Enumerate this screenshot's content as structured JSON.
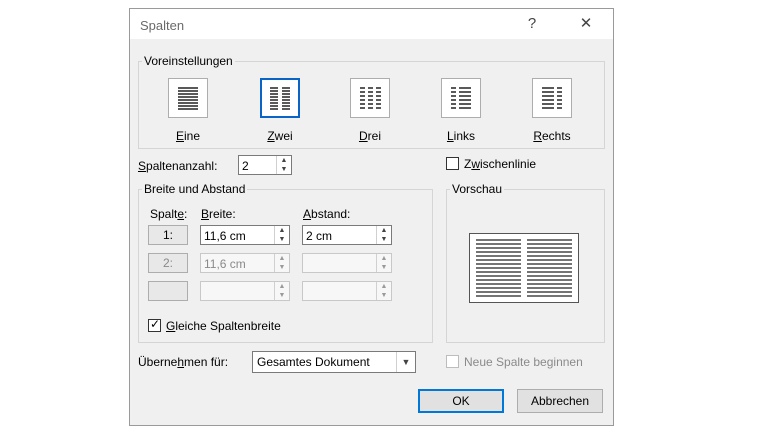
{
  "title": "Spalten",
  "titlebar": {
    "help": "?",
    "close": "✕"
  },
  "presets": {
    "label": "Voreinstellungen",
    "items": [
      {
        "label_u": "E",
        "label_rest": "ine",
        "icon": "one-column-icon"
      },
      {
        "label_u": "Z",
        "label_rest": "wei",
        "icon": "two-columns-icon",
        "selected": true
      },
      {
        "label_u": "D",
        "label_rest": "rei",
        "icon": "three-columns-icon"
      },
      {
        "label_u": "L",
        "label_rest": "inks",
        "icon": "left-columns-icon"
      },
      {
        "label_u": "R",
        "label_rest": "echts",
        "icon": "right-columns-icon"
      }
    ]
  },
  "count": {
    "label_u": "S",
    "label_rest": "paltenanzahl:",
    "value": "2"
  },
  "line_between": {
    "label_pre": "Z",
    "label_u": "w",
    "label_rest": "ischenlinie",
    "checked": false
  },
  "width_spacing": {
    "label": "Breite und Abstand",
    "col_header_pre": "Spalt",
    "col_header_u": "e",
    "col_header_post": ":",
    "width_header_u": "B",
    "width_header_rest": "reite:",
    "spacing_header_u": "A",
    "spacing_header_rest": "bstand:",
    "rows": [
      {
        "col": "1:",
        "width": "11,6 cm",
        "spacing": "2 cm",
        "enabled": true
      },
      {
        "col": "2:",
        "width": "11,6 cm",
        "spacing": "",
        "enabled": false
      },
      {
        "col": "",
        "width": "",
        "spacing": "",
        "enabled": false
      }
    ],
    "equal_width": {
      "label_u": "G",
      "label_rest": "leiche Spaltenbreite",
      "checked": true
    }
  },
  "preview": {
    "label": "Vorschau"
  },
  "apply_to": {
    "label_pre": "Überne",
    "label_u": "h",
    "label_rest": "men für:",
    "value": "Gesamtes Dokument"
  },
  "new_column": {
    "label": "Neue Spalte beginnen",
    "checked": false,
    "enabled": false
  },
  "buttons": {
    "ok": "OK",
    "cancel": "Abbrechen"
  }
}
